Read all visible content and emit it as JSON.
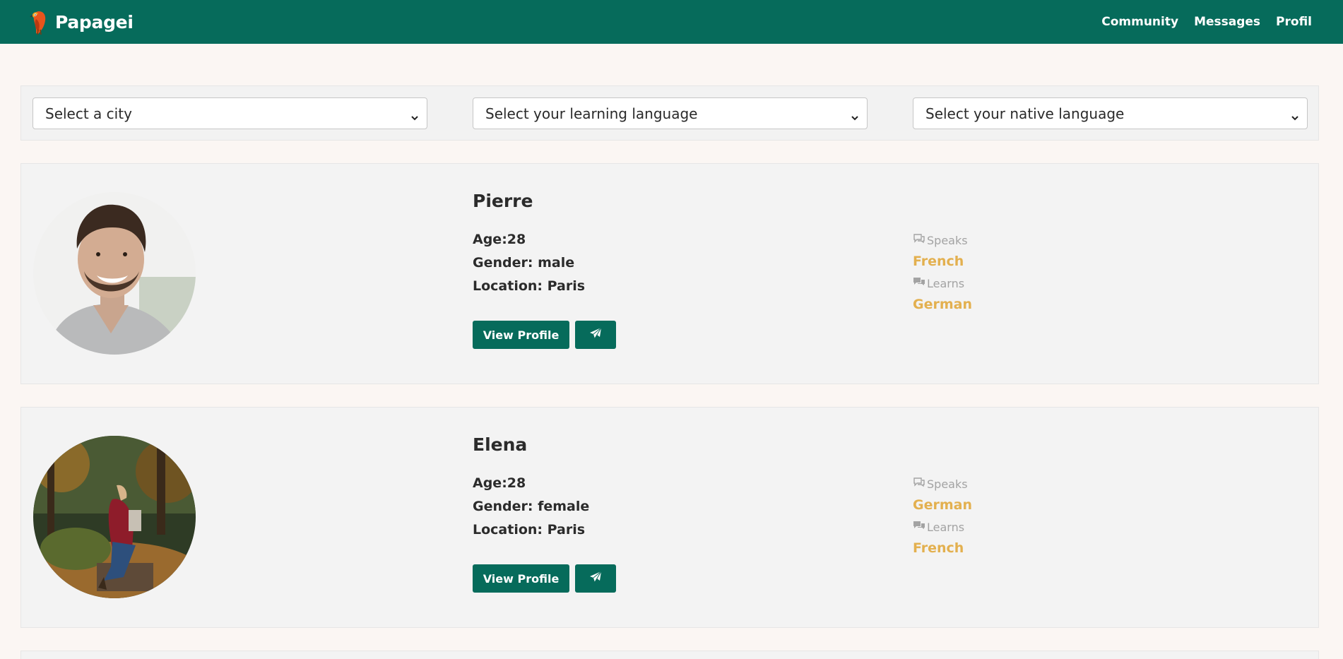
{
  "app": {
    "name": "Papagei"
  },
  "nav": {
    "links": [
      {
        "label": "Community"
      },
      {
        "label": "Messages"
      },
      {
        "label": "Profil"
      }
    ]
  },
  "filters": {
    "city": {
      "value": "Select a city"
    },
    "learning_language": {
      "value": "Select your learning language"
    },
    "native_language": {
      "value": "Select your native language"
    }
  },
  "profiles": [
    {
      "name": "Pierre",
      "age": "Age:28",
      "gender": "Gender: male",
      "location": "Location: Paris",
      "speaks_label": "Speaks",
      "speaks": "French",
      "learns_label": "Learns",
      "learns": "German",
      "view_label": "View Profile"
    },
    {
      "name": "Elena",
      "age": "Age:28",
      "gender": "Gender: female",
      "location": "Location: Paris",
      "speaks_label": "Speaks",
      "speaks": "German",
      "learns_label": "Learns",
      "learns": "French",
      "view_label": "View Profile"
    }
  ],
  "colors": {
    "primary": "#066b5b",
    "accent": "#e3b04f",
    "background": "#fbf6f3",
    "card": "#f3f3f3"
  },
  "icons": [
    "parrot-logo",
    "chevron-down-icon",
    "comment-outline-icon",
    "comments-icon",
    "paper-plane-icon"
  ]
}
